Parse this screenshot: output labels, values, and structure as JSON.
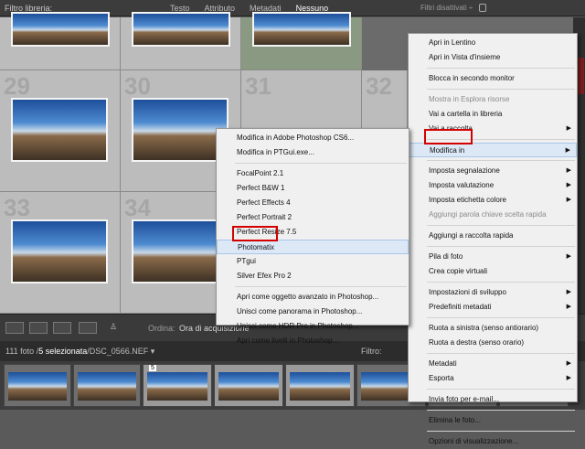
{
  "filterbar": {
    "label": "Filtro libreria:",
    "options": [
      "Testo",
      "Attributo",
      "Metadati",
      "Nessuno"
    ],
    "active_index": 3,
    "filters_state": "Filtri disattivati ÷"
  },
  "grid": {
    "numbers": [
      "29",
      "30",
      "31",
      "32",
      "33",
      "34"
    ]
  },
  "toolbar": {
    "sort_label": "Ordina:",
    "sort_value": "Ora di acquisizione"
  },
  "status": {
    "count": "111 foto /",
    "selected": "5 selezionata",
    "file": "/DSC_0566.NEF ▾",
    "filter_label": "Filtro:"
  },
  "filmstrip": {
    "badge": "5"
  },
  "main_menu": {
    "items": [
      {
        "label": "Apri in Lentino"
      },
      {
        "label": "Apri in Vista d'insieme"
      },
      {
        "sep": true
      },
      {
        "label": "Blocca in secondo monitor"
      },
      {
        "sep": true
      },
      {
        "label": "Mostra in Esplora risorse",
        "disabled": true
      },
      {
        "label": "Vai a cartella in libreria"
      },
      {
        "label": "Vai a raccolta",
        "arrow": true
      },
      {
        "sep": true
      },
      {
        "label": "Modifica in",
        "arrow": true,
        "hl": true
      },
      {
        "sep": true
      },
      {
        "label": "Imposta segnalazione",
        "arrow": true
      },
      {
        "label": "Imposta valutazione",
        "arrow": true
      },
      {
        "label": "Imposta etichetta colore",
        "arrow": true
      },
      {
        "label": "Aggiungi parola chiave scelta rapida",
        "disabled": true
      },
      {
        "sep": true
      },
      {
        "label": "Aggiungi a raccolta rapida"
      },
      {
        "sep": true
      },
      {
        "label": "Pila di foto",
        "arrow": true
      },
      {
        "label": "Crea copie virtuali"
      },
      {
        "sep": true
      },
      {
        "label": "Impostazioni di sviluppo",
        "arrow": true
      },
      {
        "label": "Predefiniti metadati",
        "arrow": true
      },
      {
        "sep": true
      },
      {
        "label": "Ruota a sinistra (senso antiorario)"
      },
      {
        "label": "Ruota a destra (senso orario)"
      },
      {
        "sep": true
      },
      {
        "label": "Metadati",
        "arrow": true
      },
      {
        "label": "Esporta",
        "arrow": true
      },
      {
        "sep": true
      },
      {
        "label": "Invia foto per e-mail..."
      },
      {
        "sep": true
      },
      {
        "label": "Elimina le foto..."
      },
      {
        "sep": true
      },
      {
        "label": "Opzioni di visualizzazione..."
      }
    ]
  },
  "sub_menu": {
    "items": [
      {
        "label": "Modifica in Adobe Photoshop CS6..."
      },
      {
        "label": "Modifica in PTGui.exe..."
      },
      {
        "sep": true
      },
      {
        "label": "FocalPoint 2.1"
      },
      {
        "label": "Perfect B&W 1"
      },
      {
        "label": "Perfect Effects 4"
      },
      {
        "label": "Perfect Portrait 2"
      },
      {
        "label": "Perfect Resize 7.5"
      },
      {
        "label": "Photomatix",
        "hl": true
      },
      {
        "label": "PTgui"
      },
      {
        "label": "Silver Efex Pro 2"
      },
      {
        "sep": true
      },
      {
        "label": "Apri come oggetto avanzato in Photoshop..."
      },
      {
        "label": "Unisci come panorama in Photoshop..."
      },
      {
        "label": "Unisci come HDR Pro in Photoshop..."
      },
      {
        "label": "Apri come livelli in Photoshop..."
      }
    ]
  }
}
